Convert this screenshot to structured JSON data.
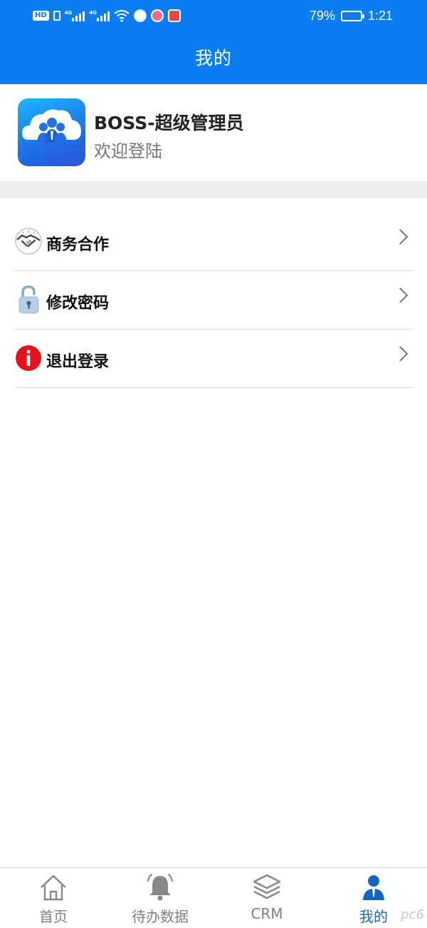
{
  "status_bar": {
    "hd": "HD",
    "net1": "4G",
    "net2": "4G",
    "battery_text": "79%",
    "battery_level": 0.79,
    "time": "1:21"
  },
  "header": {
    "title": "我的"
  },
  "profile": {
    "name": "BOSS-超级管理员",
    "subtitle": "欢迎登陆"
  },
  "menu": {
    "items": [
      {
        "label": "商务合作",
        "icon": "handshake-icon"
      },
      {
        "label": "修改密码",
        "icon": "lock-icon"
      },
      {
        "label": "退出登录",
        "icon": "info-icon"
      }
    ]
  },
  "nav": {
    "items": [
      {
        "label": "首页",
        "icon": "home-icon",
        "active": false
      },
      {
        "label": "待办数据",
        "icon": "bell-icon",
        "active": false
      },
      {
        "label": "CRM",
        "icon": "layers-icon",
        "active": false
      },
      {
        "label": "我的",
        "icon": "user-icon",
        "active": true
      }
    ]
  },
  "colors": {
    "primary": "#0a7df3",
    "active_nav": "#1565c0",
    "exit_red": "#e8101a"
  },
  "watermark": "pc6"
}
